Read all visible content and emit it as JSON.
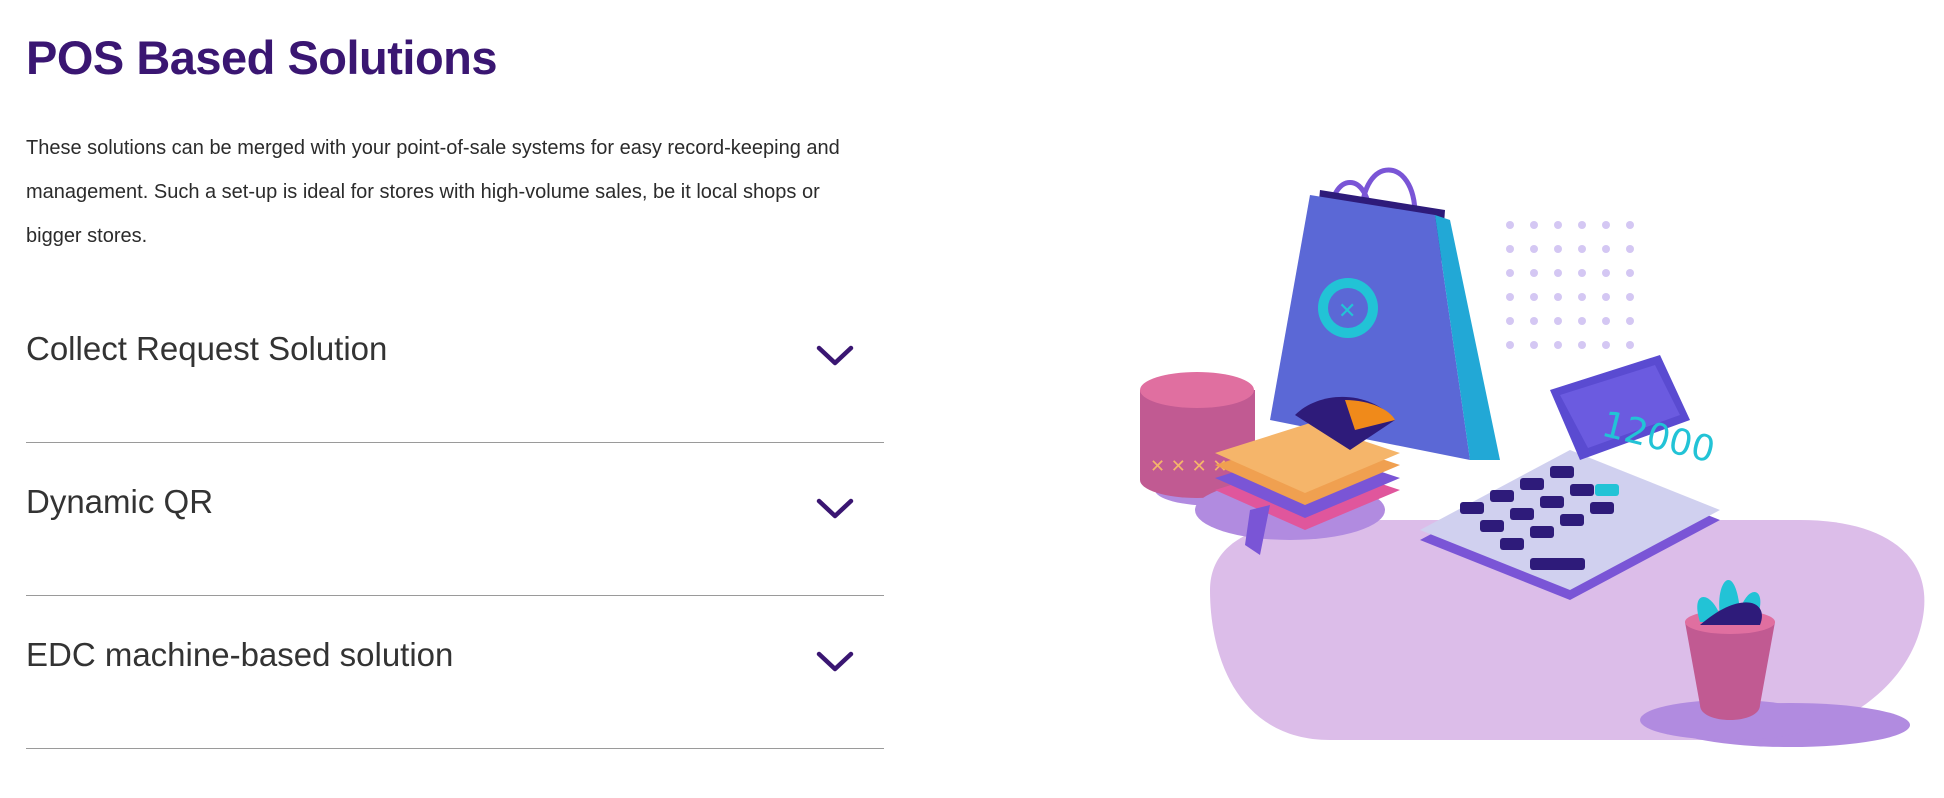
{
  "section": {
    "title": "POS Based Solutions",
    "description": "These solutions can be merged with your point-of-sale systems for easy record-keeping and management. Such a set-up is ideal for stores with high-volume sales, be it local shops or bigger stores."
  },
  "accordion": {
    "items": [
      {
        "label": "Collect Request Solution",
        "icon": "chevron-down-icon"
      },
      {
        "label": "Dynamic QR",
        "icon": "chevron-down-icon"
      },
      {
        "label": "EDC machine-based solution",
        "icon": "chevron-down-icon"
      }
    ]
  },
  "illustration": {
    "calculator_display": "12000"
  },
  "colors": {
    "title": "#3a1672",
    "accent_purple": "#3a1672",
    "divider": "#9a9a9a",
    "bag_blue": "#5b68d6",
    "teal": "#22c3d6",
    "lavender": "#dcbde9"
  }
}
